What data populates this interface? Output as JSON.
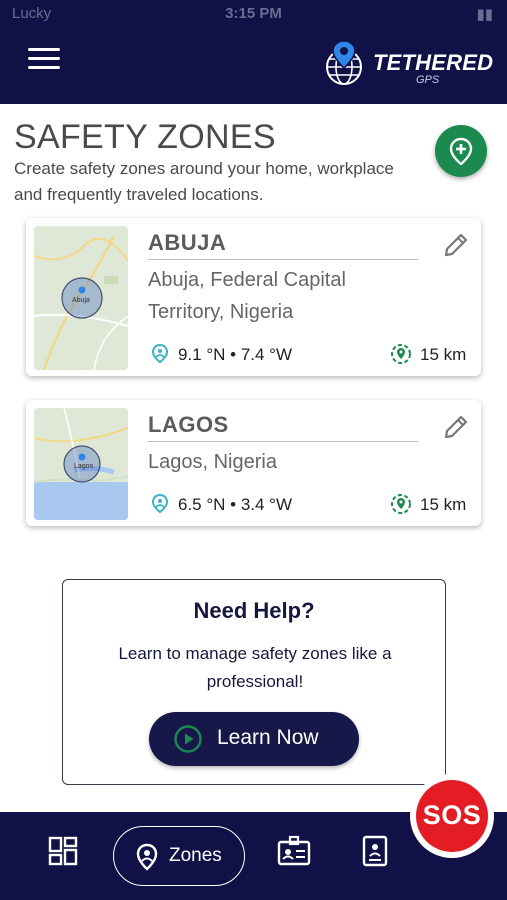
{
  "status_bar": {
    "carrier": "Lucky",
    "time": "3:15 PM"
  },
  "header": {
    "brand": "TETHERED",
    "brand_sub": "GPS"
  },
  "page": {
    "title": "SAFETY ZONES",
    "description": "Create safety zones around your home, workplace and frequently traveled locations."
  },
  "zones": [
    {
      "name": "ABUJA",
      "address": "Abuja, Federal Capital Territory, Nigeria",
      "coords": "9.1 °N • 7.4 °W",
      "radius": "15 km",
      "map_label": "Abuja"
    },
    {
      "name": "LAGOS",
      "address": "Lagos, Nigeria",
      "coords": "6.5 °N • 3.4 °W",
      "radius": "15 km",
      "map_label": "Lagos"
    }
  ],
  "help": {
    "title": "Need Help?",
    "text": "Learn to manage safety zones like a professional!",
    "button_label": "Learn Now"
  },
  "nav": {
    "zones_label": "Zones",
    "sos_label": "SOS"
  },
  "colors": {
    "navy": "#0f1147",
    "green": "#1b8a4f",
    "sos_red": "#e41d24",
    "teal_icon": "#39b3c4"
  },
  "icons": [
    "menu-icon",
    "globe-pin-icon",
    "add-location-icon",
    "edit-pencil-icon",
    "coordinates-pin-icon",
    "radius-icon",
    "play-circle-icon",
    "dashboard-icon",
    "location-icon",
    "id-card-icon",
    "document-icon"
  ]
}
